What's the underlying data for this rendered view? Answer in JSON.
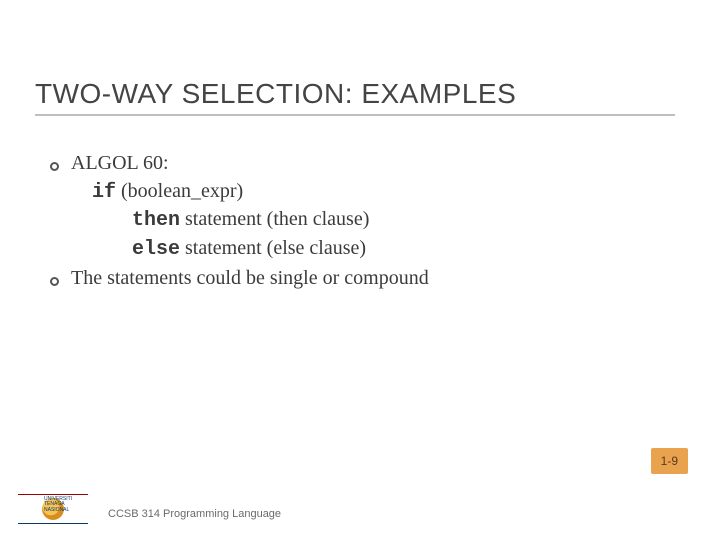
{
  "title": "TWO-WAY SELECTION: EXAMPLES",
  "bullets": [
    {
      "lead": "ALGOL 60:",
      "code": {
        "line1_kw": "if",
        "line1_rest": " (boolean_expr)",
        "line2_kw": "then",
        "line2_rest": " statement  (then clause)",
        "line3_kw": "else",
        "line3_rest": " statement  (else clause)"
      }
    },
    {
      "lead": "The statements could be single or compound"
    }
  ],
  "page_label": "1-9",
  "footer_text": "CCSB 314 Programming Language",
  "logo": {
    "line1": "UNIVERSITI",
    "line2": "TENAGA",
    "line3": "NASIONAL"
  }
}
